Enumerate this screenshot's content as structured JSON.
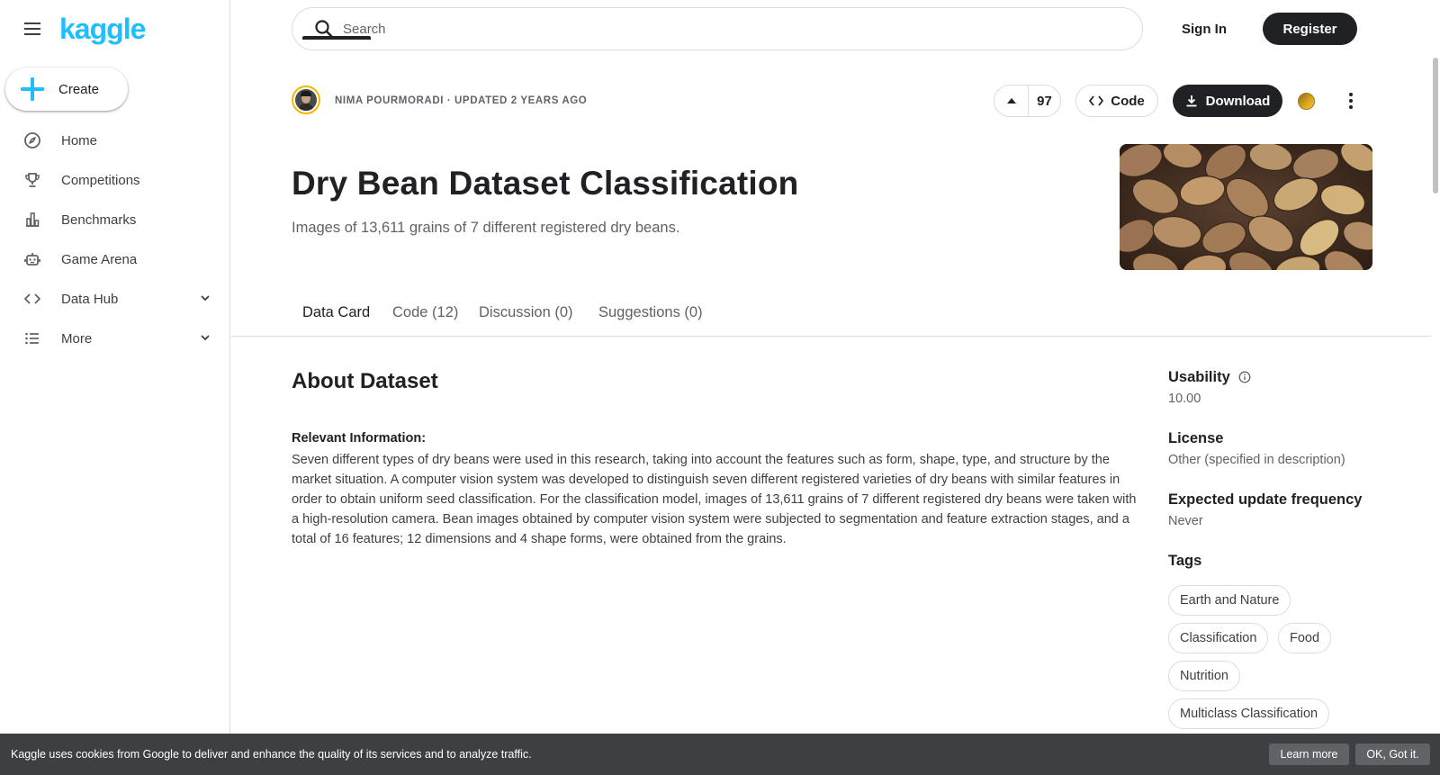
{
  "brand": {
    "logo_text": "kaggle",
    "accent": "#20beff",
    "dark": "#202124"
  },
  "sidebar": {
    "create_label": "Create",
    "items": [
      {
        "label": "Home",
        "icon": "compass-icon"
      },
      {
        "label": "Competitions",
        "icon": "trophy-icon"
      },
      {
        "label": "Benchmarks",
        "icon": "bar-chart-icon"
      },
      {
        "label": "Game Arena",
        "icon": "robot-icon"
      },
      {
        "label": "Data Hub",
        "icon": "code-brackets-icon",
        "expandable": true
      },
      {
        "label": "More",
        "icon": "list-icon",
        "expandable": true
      }
    ]
  },
  "topbar": {
    "search_placeholder": "Search",
    "sign_in": "Sign In",
    "register": "Register"
  },
  "dataset": {
    "owner_line": "NIMA POURMORADI · UPDATED 2 YEARS AGO",
    "votes": "97",
    "code_label": "Code",
    "download_label": "Download",
    "title": "Dry Bean Dataset Classification",
    "subtitle": "Images of 13,611 grains of 7 different registered dry beans."
  },
  "tabs": [
    {
      "label": "Data Card",
      "active": true
    },
    {
      "label": "Code (12)",
      "active": false
    },
    {
      "label": "Discussion (0)",
      "active": false
    },
    {
      "label": "Suggestions (0)",
      "active": false
    }
  ],
  "about": {
    "heading": "About Dataset",
    "section_heading": "Relevant Information:",
    "body": "Seven different types of dry beans were used in this research, taking into account the features such as form, shape, type, and structure by the market situation. A computer vision system was developed to distinguish seven different registered varieties of dry beans with similar features in order to obtain uniform seed classification. For the classification model, images of 13,611 grains of 7 different registered dry beans were taken with a high-resolution camera. Bean images obtained by computer vision system were subjected to segmentation and feature extraction stages, and a total of 16 features; 12 dimensions and 4 shape forms, were obtained from the grains."
  },
  "meta": {
    "usability_label": "Usability",
    "usability_value": "10.00",
    "license_label": "License",
    "license_value": "Other (specified in description)",
    "frequency_label": "Expected update frequency",
    "frequency_value": "Never",
    "tags_label": "Tags",
    "tags": [
      "Earth and Nature",
      "Classification",
      "Food",
      "Nutrition",
      "Multiclass Classification"
    ]
  },
  "cookie": {
    "text": "Kaggle uses cookies from Google to deliver and enhance the quality of its services and to analyze traffic.",
    "learn_more": "Learn more",
    "ok": "OK, Got it."
  }
}
